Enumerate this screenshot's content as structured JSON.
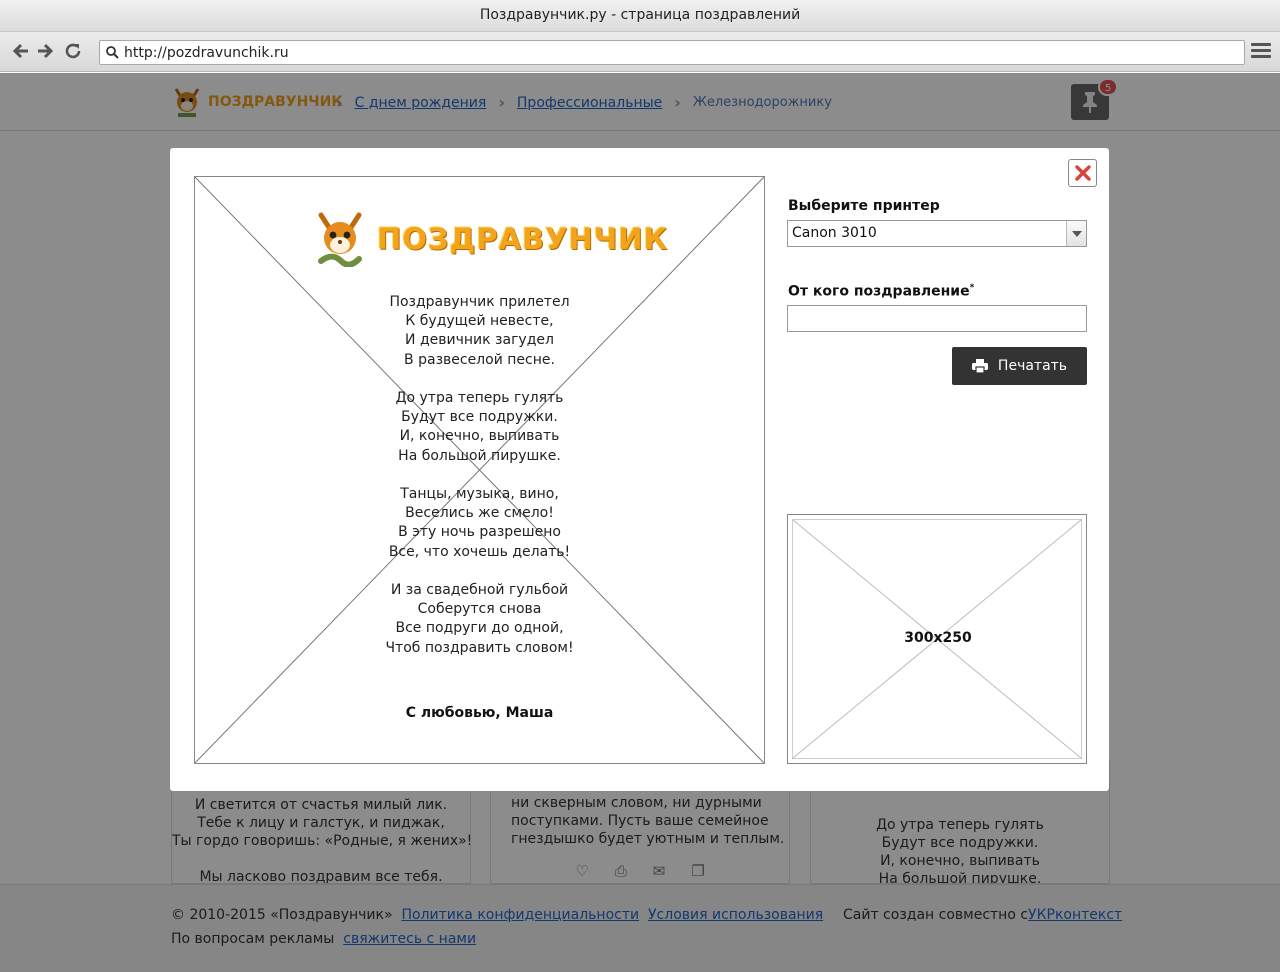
{
  "browser": {
    "window_title": "Поздравунчик.ру - страница поздравлений",
    "url": "http://pozdravunchik.ru",
    "icons": {
      "back": "arrow-left-icon",
      "forward": "arrow-right-icon",
      "reload": "reload-icon",
      "menu": "hamburger-menu-icon"
    }
  },
  "site": {
    "logo_text": "ПОЗДРАВУНЧИК",
    "breadcrumbs": {
      "item1": "С днем рождения",
      "item2": "Профессиональные",
      "current": "Железнодорожнику"
    },
    "pin_badge_count": "5",
    "background_cards": {
      "card1": [
        "И светится от счастья милый лик.",
        "Тебе к лицу и галстук, и пиджак,",
        "Ты гордо говоришь: «Родные, я жених»!",
        "",
        "Мы ласково поздравим все тебя."
      ],
      "card2": [
        "ни скверным словом, ни дурными",
        "поступками. Пусть ваше семейное",
        "гнездышко будет уютным и теплым."
      ],
      "card3": [
        "До утра теперь гулять",
        "Будут все подружки.",
        "И, конечно, выпивать",
        "На большой пирушке."
      ]
    }
  },
  "footer": {
    "copyright": "© 2010-2015 «Поздравунчик»",
    "privacy_link": "Политика конфиденциальности",
    "terms_link": "Условия использования",
    "ads_text": "По вопросам рекламы",
    "contact_link": "свяжитесь с нами",
    "partner_text": "Сайт создан совместно с",
    "partner_link": "УКРконтекст"
  },
  "modal": {
    "preview": {
      "logo_text": "ПОЗДРАВУНЧИК",
      "poem_stanzas": [
        [
          "Поздравунчик прилетел",
          "К будущей невесте,",
          "И девичник загудел",
          "В развеселой песне."
        ],
        [
          "До утра теперь гулять",
          "Будут все подружки.",
          "И, конечно, выпивать",
          "На большой пирушке."
        ],
        [
          "Танцы, музыка, вино,",
          "Веселись же смело!",
          "В эту ночь разрешено",
          "Все, что хочешь делать!"
        ],
        [
          "И за свадебной гульбой",
          "Соберутся снова",
          "Все подруги до одной,",
          "Чтоб поздравить словом!"
        ]
      ],
      "signature": "С любовью, Маша"
    },
    "printer_label": "Выберите принтер",
    "printer_selected": "Canon 3010",
    "from_label": "От кого поздравление",
    "from_required_mark": "*",
    "from_value": "",
    "print_button": "Печатать",
    "ad_placeholder": "300x250",
    "icons": {
      "close": "close-icon",
      "print": "printer-icon"
    }
  }
}
